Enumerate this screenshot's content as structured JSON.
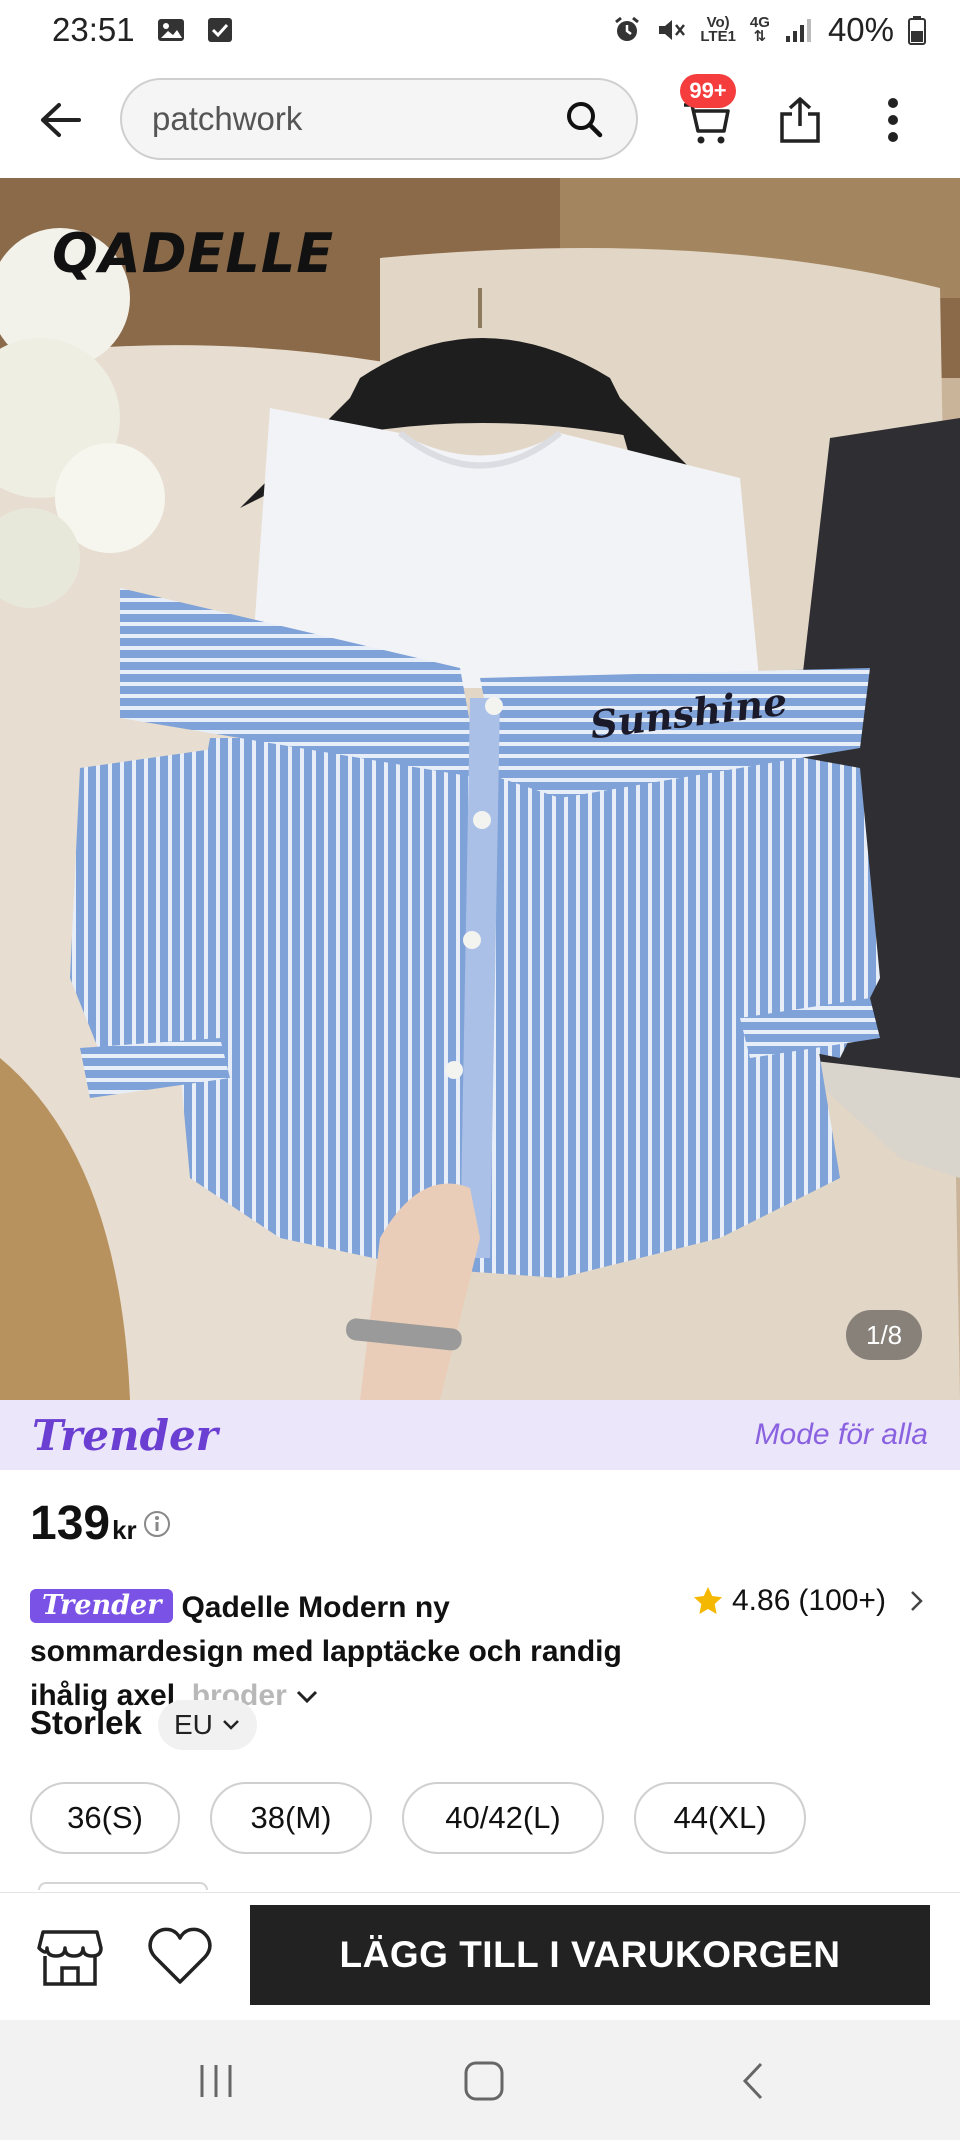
{
  "status_bar": {
    "time": "23:51",
    "network_top": "Vo)",
    "network_bottom": "LTE1",
    "data_top": "4G",
    "battery_percent": "40%"
  },
  "header": {
    "search_query": "patchwork",
    "cart_badge": "99+"
  },
  "product_image": {
    "brand_logo": "QADELLE",
    "shirt_text": "Sunshine",
    "page_indicator": "1/8"
  },
  "banner": {
    "logo": "Trender",
    "slogan": "Mode för alla"
  },
  "product": {
    "price_value": "139",
    "price_currency": "kr",
    "tag": "Trender",
    "title_main": "Qadelle Modern ny sommardesign med lapptäcke och randig ihålig axel, ",
    "title_fade": "broder",
    "rating_value": "4.86",
    "rating_count": "(100+)"
  },
  "size": {
    "label": "Storlek",
    "system": "EU",
    "options": [
      "36(S)",
      "38(M)",
      "40/42(L)",
      "44(XL)"
    ]
  },
  "action_bar": {
    "add_to_cart_label": "LÄGG TILL I VARUKORGEN"
  },
  "colors": {
    "accent_purple": "#7a52e6",
    "badge_red": "#f53d3d",
    "button_dark": "#222222",
    "rating_star": "#f5b800"
  }
}
